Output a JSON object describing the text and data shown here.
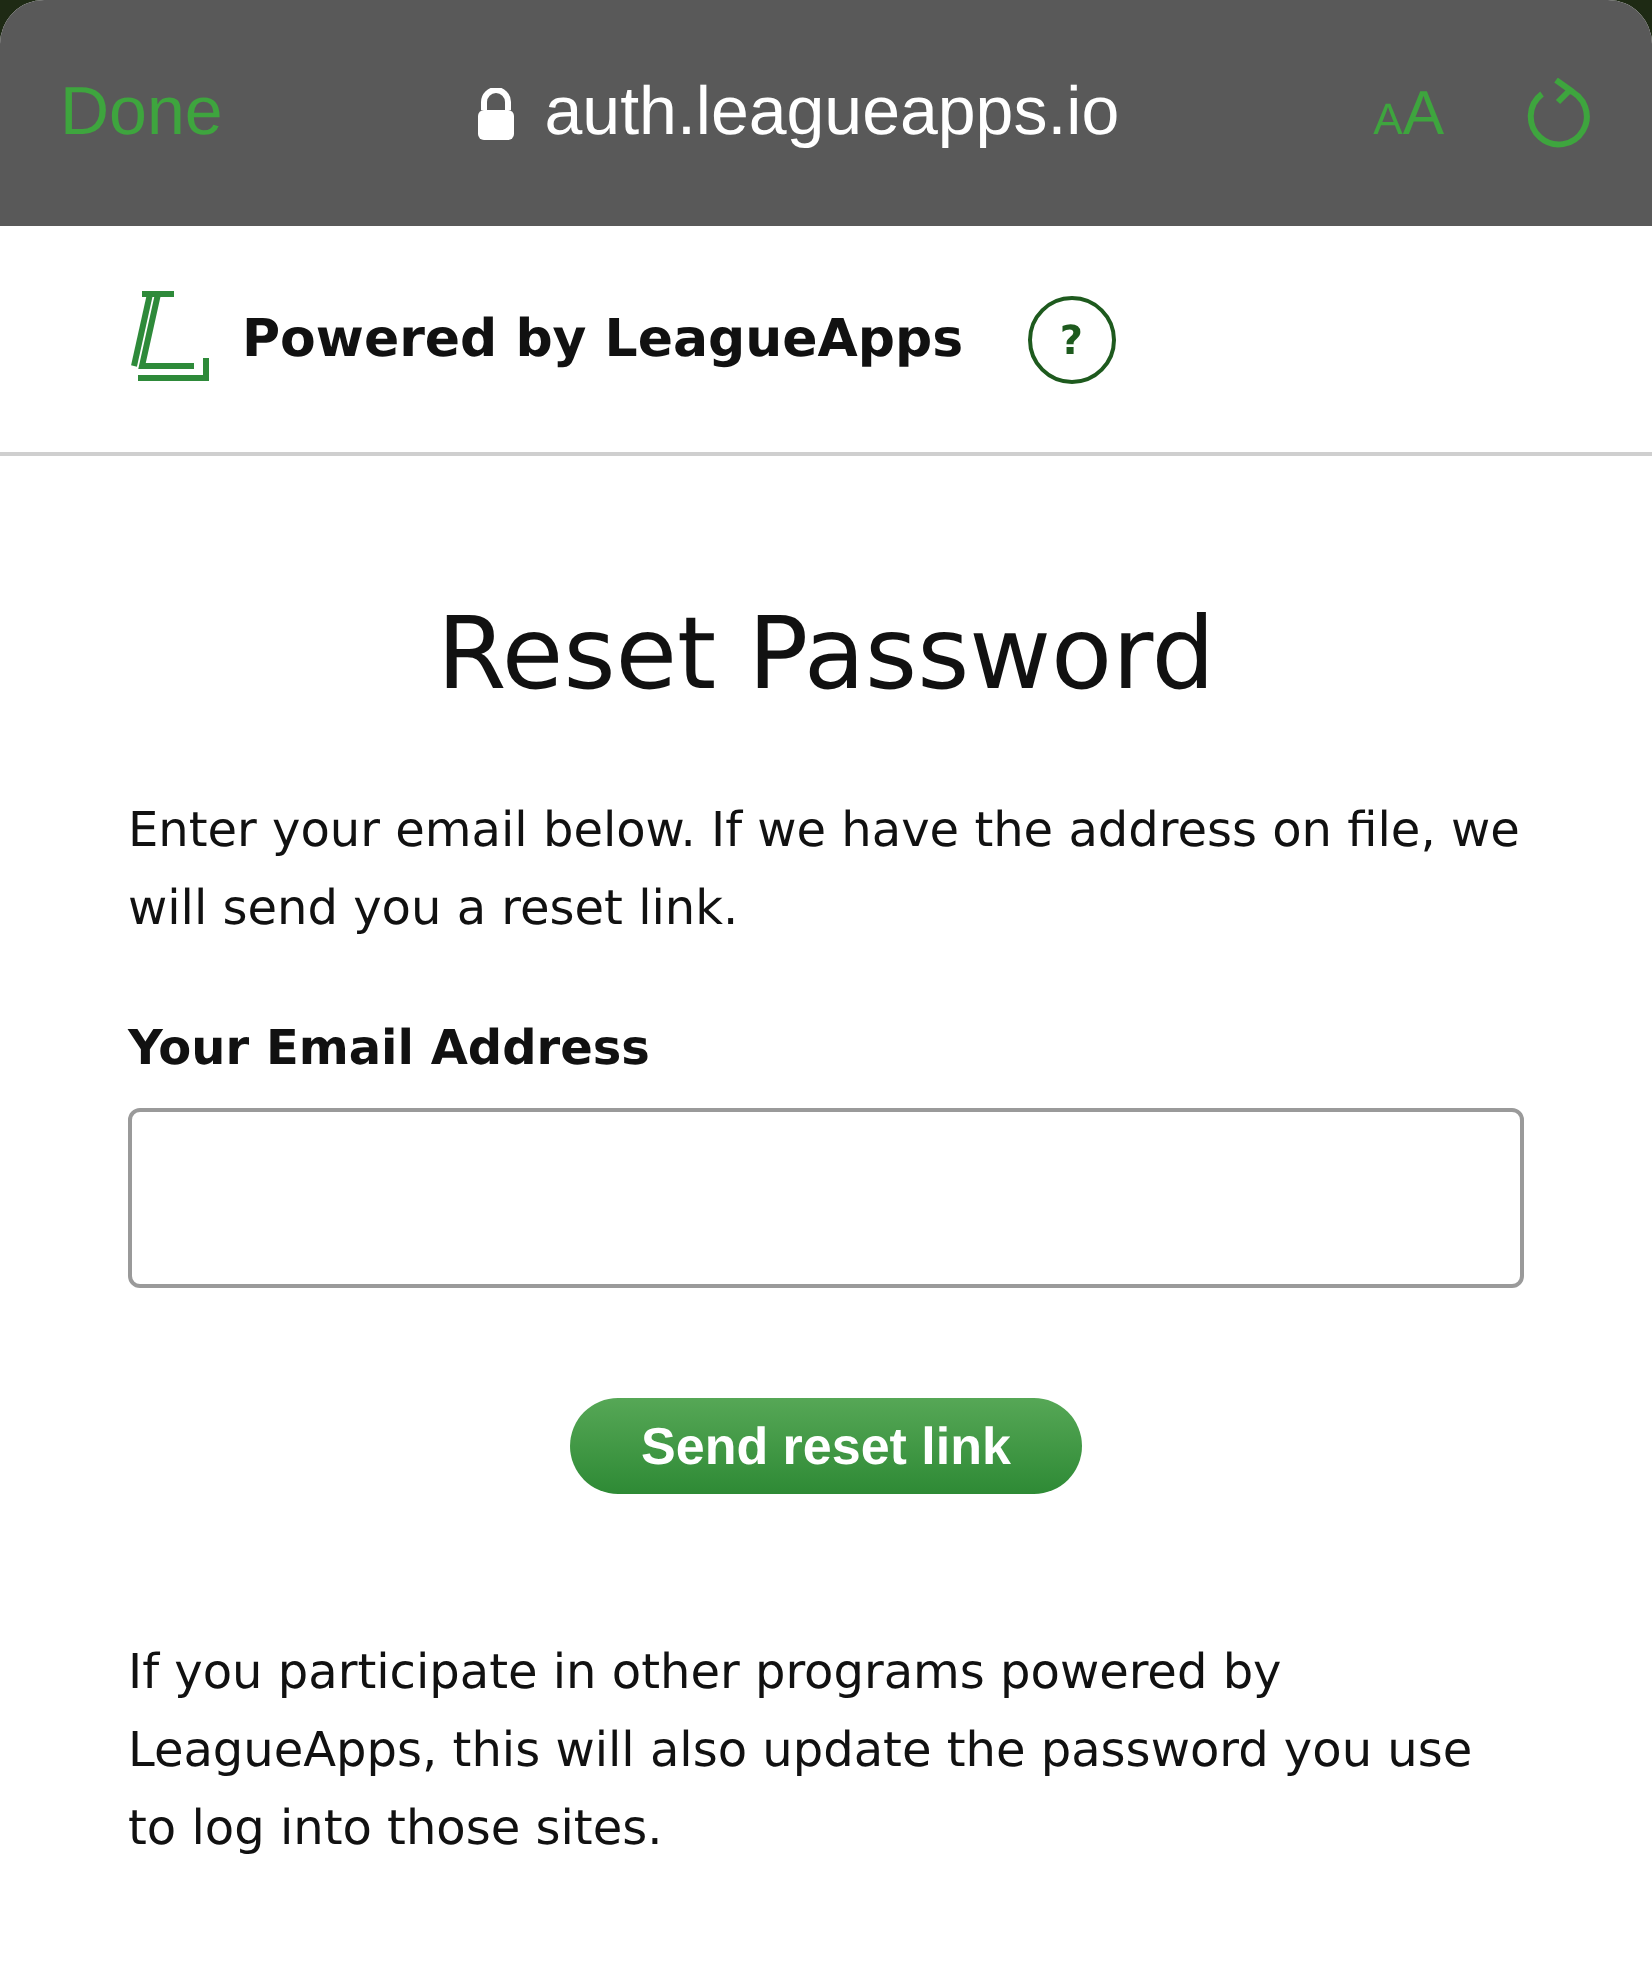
{
  "browser_bar": {
    "done": "Done",
    "url": "auth.leagueapps.io",
    "text_size": {
      "small": "A",
      "large": "A"
    }
  },
  "header": {
    "powered_by": "Powered by LeagueApps",
    "help": "?"
  },
  "title": "Reset Password",
  "intro": "Enter your email below. If we have the address on file, we will send you a reset link.",
  "email_field": {
    "label": "Your Email Address"
  },
  "submit": "Send reset link",
  "note": "If you participate in other programs powered by LeagueApps, this will also update the password you use to log into those sites."
}
